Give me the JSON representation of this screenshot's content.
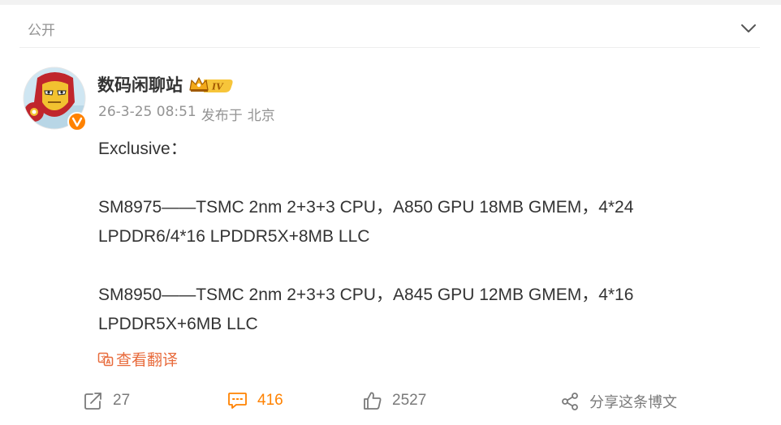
{
  "visibility": {
    "label": "公开"
  },
  "author": {
    "name": "数码闲聊站",
    "badge_level": "IV"
  },
  "meta": {
    "timestamp": "26-3-25 08:51",
    "source_prefix": "发布于",
    "location": "北京"
  },
  "post": {
    "lines": [
      "Exclusive：",
      "",
      "SM8975——TSMC 2nm 2+3+3 CPU，A850 GPU 18MB GMEM，4*24",
      "LPDDR6/4*16 LPDDR5X+8MB LLC",
      "",
      "SM8950——TSMC 2nm 2+3+3 CPU，A845 GPU 12MB GMEM，4*16",
      "LPDDR5X+6MB LLC"
    ],
    "translate_label": "查看翻译"
  },
  "actions": {
    "repost_count": "27",
    "comment_count": "416",
    "like_count": "2527",
    "share_label": "分享这条博文"
  },
  "colors": {
    "accent_orange": "#ff8200",
    "translate": "#e86b3c",
    "muted": "#939393",
    "text": "#333333"
  },
  "icons": {
    "collapse": "chevron-down-icon",
    "repost": "repost-icon",
    "comment": "comment-icon",
    "like": "thumbs-up-icon",
    "share": "share-icon",
    "translate": "translate-icon",
    "verified": "verified-v-icon",
    "crown": "crown-icon"
  }
}
